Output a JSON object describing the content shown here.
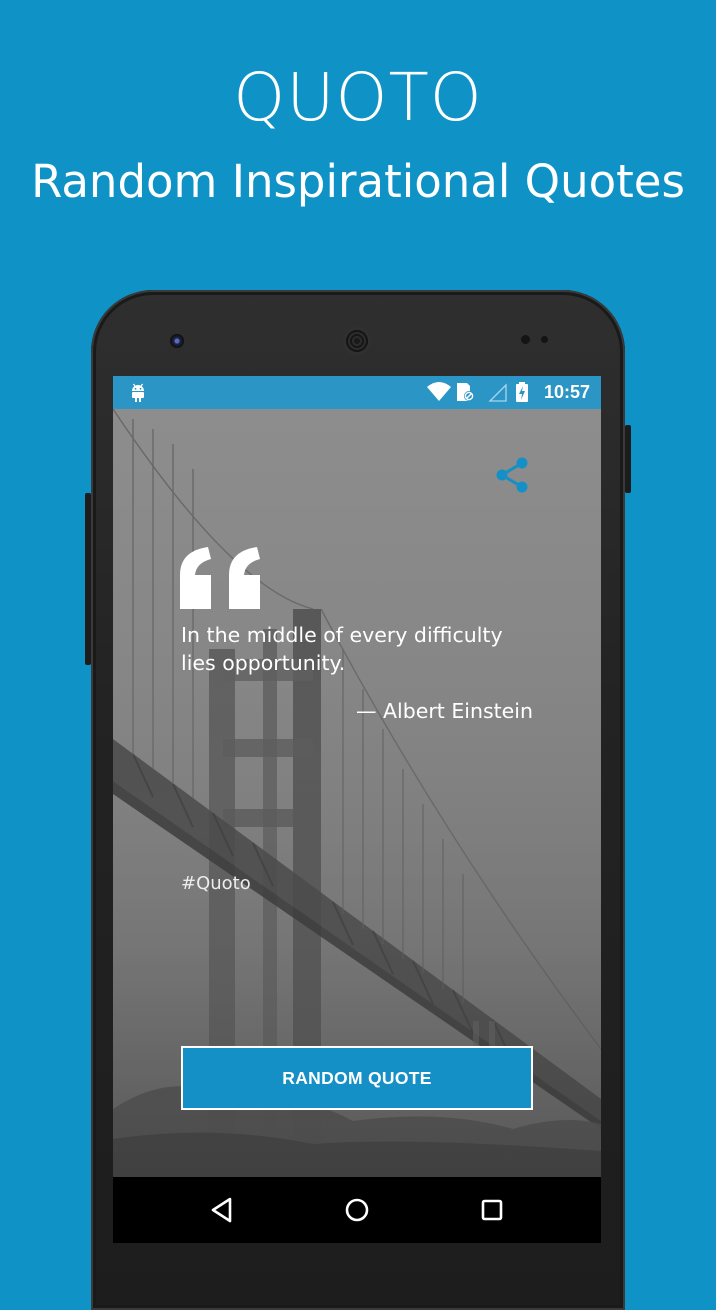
{
  "promo": {
    "title": "QUOTO",
    "subtitle": "Random Inspirational Quotes"
  },
  "status_bar": {
    "time": "10:57",
    "icons": [
      "android-debug-icon",
      "wifi-icon",
      "sim-icon",
      "signal-icon",
      "battery-charging-icon"
    ]
  },
  "quote": {
    "text": "In the middle of every difficulty lies opportunity.",
    "author": "— Albert Einstein",
    "hashtag": "#Quoto"
  },
  "actions": {
    "random_button_label": "RANDOM QUOTE",
    "share_icon": "share-icon"
  },
  "nav_bar": {
    "icons": [
      "back-icon",
      "home-icon",
      "recents-icon"
    ]
  },
  "colors": {
    "background": "#0f93c6",
    "status_bar": "#2b95c5",
    "accent": "#1590c6",
    "button_border": "#ffffff"
  }
}
